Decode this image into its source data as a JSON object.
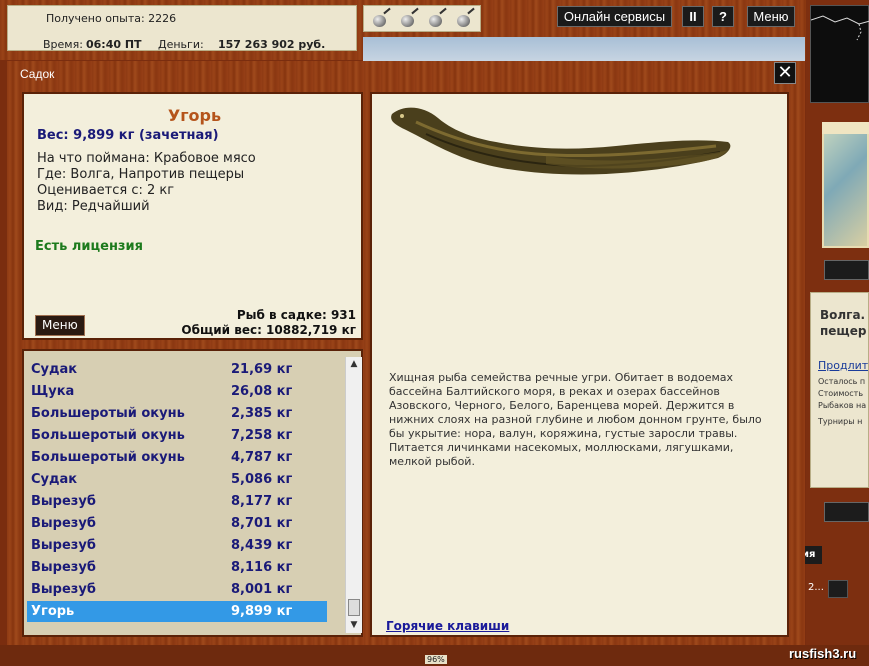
{
  "status": {
    "experience": "Получено опыта: 2226",
    "time_label": "Время:",
    "time_value": "06:40 ПТ",
    "money_label": "Деньги:",
    "money_value": "157 263 902 руб."
  },
  "toolbar": {
    "online_services": "Онлайн сервисы",
    "pause_glyph": "II",
    "help_glyph": "?",
    "menu": "Меню"
  },
  "dialog": {
    "title": "Садок",
    "close_glyph": "✕"
  },
  "fish": {
    "name": "Угорь",
    "weight": "Вес: 9,899 кг (зачетная)",
    "bait": "На что поймана: Крабовое мясо",
    "place": "Где: Волга, Напротив пещеры",
    "rated": "Оценивается с: 2 кг",
    "kind": "Вид: Редчайший",
    "license": "Есть лицензия",
    "menu_button": "Меню",
    "keep_count": "Рыб в садке: 931",
    "total_weight": "Общий вес: 10882,719 кг",
    "description": "Хищная рыба семейства речные угри. Обитает в водоемах бассейна Балтийского моря, в реках и озерах бассейнов Азовского, Черного, Белого, Баренцева морей. Держится в нижних слоях на разной глубине и любом донном грунте, было бы укрытие: нора, валун, коряжина, густые заросли травы. Питается личинками насекомых, моллюсками, лягушками, мелкой рыбой.",
    "hotkeys": "Горячие клавиши"
  },
  "catch_list": [
    {
      "name": "Судак",
      "weight": "21,69 кг"
    },
    {
      "name": "Щука",
      "weight": "26,08 кг"
    },
    {
      "name": "Большеротый окунь",
      "weight": "2,385 кг"
    },
    {
      "name": "Большеротый окунь",
      "weight": "7,258 кг"
    },
    {
      "name": "Большеротый окунь",
      "weight": "4,787 кг"
    },
    {
      "name": "Судак",
      "weight": "5,086 кг"
    },
    {
      "name": "Вырезуб",
      "weight": "8,177 кг"
    },
    {
      "name": "Вырезуб",
      "weight": "8,701 кг"
    },
    {
      "name": "Вырезуб",
      "weight": "8,439 кг"
    },
    {
      "name": "Вырезуб",
      "weight": "8,116 кг"
    },
    {
      "name": "Вырезуб",
      "weight": "8,001 кг"
    },
    {
      "name": "Угорь",
      "weight": "9,899 кг"
    }
  ],
  "peek": {
    "title1": "Волга.",
    "title2": "пещер",
    "link": "Продлить",
    "line1": "Осталось п",
    "line2": "Стоимость",
    "line3": "Рыбаков на",
    "line4": "Турниры н",
    "tab": "ия",
    "num": "2..."
  },
  "bottom": {
    "percent": "96%",
    "watermark": "rusfish3.ru"
  },
  "colors": {
    "wood": "#8e3a13",
    "panel": "#f3efdc",
    "accent_name": "#b5541b",
    "list_text": "#1a1a78",
    "selected": "#3399e6",
    "license": "#1c7a1c"
  }
}
